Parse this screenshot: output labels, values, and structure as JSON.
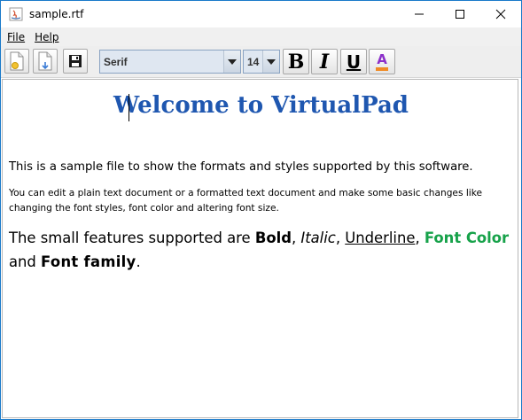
{
  "window": {
    "title": "sample.rtf",
    "minimize_glyph": "—",
    "maximize_glyph": "☐",
    "close_glyph": "✕"
  },
  "menu": {
    "items": [
      {
        "label": "File"
      },
      {
        "label": "Help"
      }
    ]
  },
  "toolbar": {
    "font_family": "Serif",
    "font_size": "14",
    "bold_label": "B",
    "italic_label": "I",
    "underline_label": "U",
    "color_label": "A",
    "colors": {
      "font_color_bar": "#8b2fc9",
      "font_color_bar2": "#f08a24"
    }
  },
  "document": {
    "title": "Welcome to VirtualPad",
    "title_color": "#1f57b0",
    "para1": "This is a sample file to show the formats and styles supported by this software.",
    "para2": "You can edit a plain text document or a formatted text document and make some basic changes like changing the font styles, font color and altering font size.",
    "para3": {
      "intro": "The small features supported are ",
      "bold": "Bold",
      "sep1": ", ",
      "italic": "Italic",
      "sep2": ", ",
      "underline": "Underline",
      "sep3": ", ",
      "font_color": "Font Color",
      "and": " and ",
      "font_family": "Font family",
      "end": "."
    },
    "accent_green": "#17a24a"
  }
}
